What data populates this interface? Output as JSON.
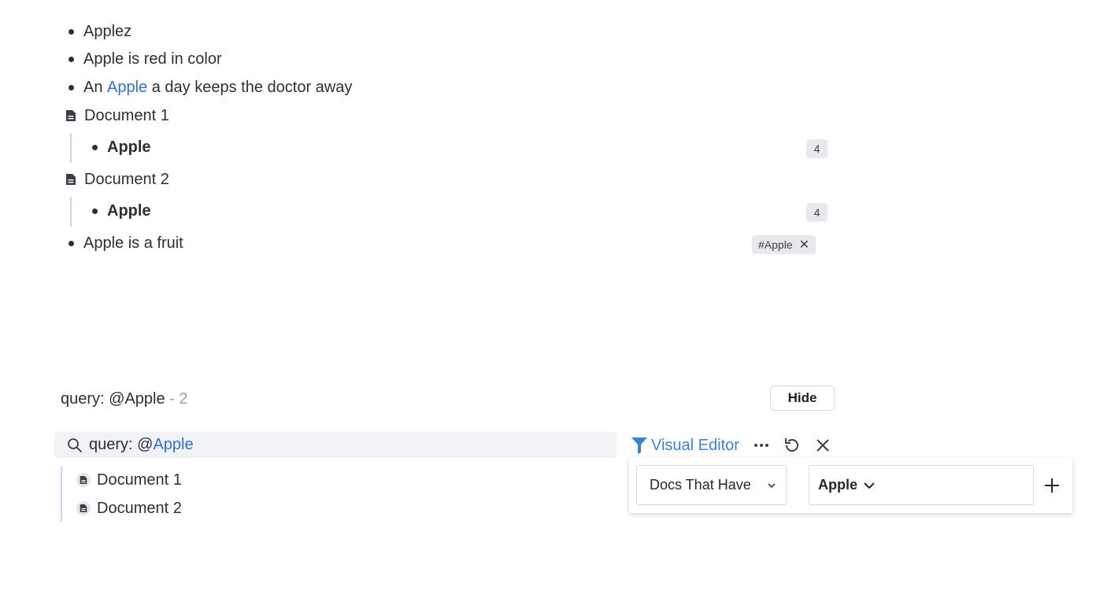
{
  "outline": {
    "items": [
      {
        "text": "Applez"
      },
      {
        "text": "Apple is red in color"
      },
      {
        "prefix": "An ",
        "link": "Apple",
        "suffix": " a day keeps the doctor away"
      }
    ],
    "documents": [
      {
        "title": "Document 1",
        "child": "Apple",
        "count": "4"
      },
      {
        "title": "Document 2",
        "child": "Apple",
        "count": "4"
      }
    ],
    "last_item": {
      "text": "Apple is a fruit",
      "tag": "#Apple"
    }
  },
  "query": {
    "title": "query: @Apple",
    "count": " - 2",
    "hide_label": "Hide",
    "search_prefix": "query: @",
    "search_link": "Apple",
    "visual_editor_label": "Visual Editor",
    "results": [
      "Document 1",
      "Document 2"
    ]
  },
  "filter": {
    "condition": "Docs That Have",
    "value": "Apple"
  },
  "colors": {
    "link": "#2f6fd6",
    "accent": "#3b82d6"
  },
  "icons": [
    "document-icon",
    "search-icon",
    "filter-icon",
    "more-icon",
    "refresh-icon",
    "close-icon",
    "chevron-down-icon",
    "plus-icon"
  ]
}
